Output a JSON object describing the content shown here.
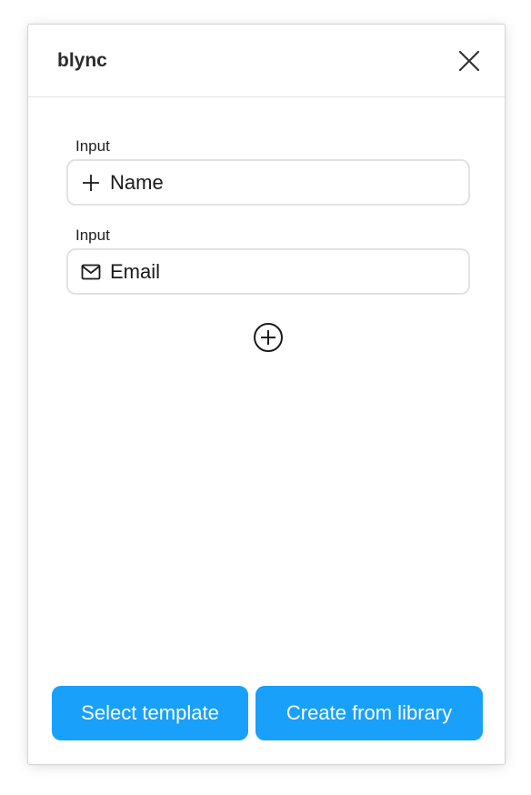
{
  "header": {
    "title": "blync",
    "close_icon": "close-icon"
  },
  "fields": [
    {
      "label": "Input",
      "value": "Name",
      "icon": "plus-icon"
    },
    {
      "label": "Input",
      "value": "Email",
      "icon": "mail-icon"
    }
  ],
  "add_field_icon": "circle-plus-icon",
  "footer": {
    "select_template_label": "Select template",
    "create_from_library_label": "Create from library"
  },
  "colors": {
    "primary_button": "#18a0fb",
    "field_border": "#e2e2e2",
    "divider": "#e3e3e3"
  }
}
